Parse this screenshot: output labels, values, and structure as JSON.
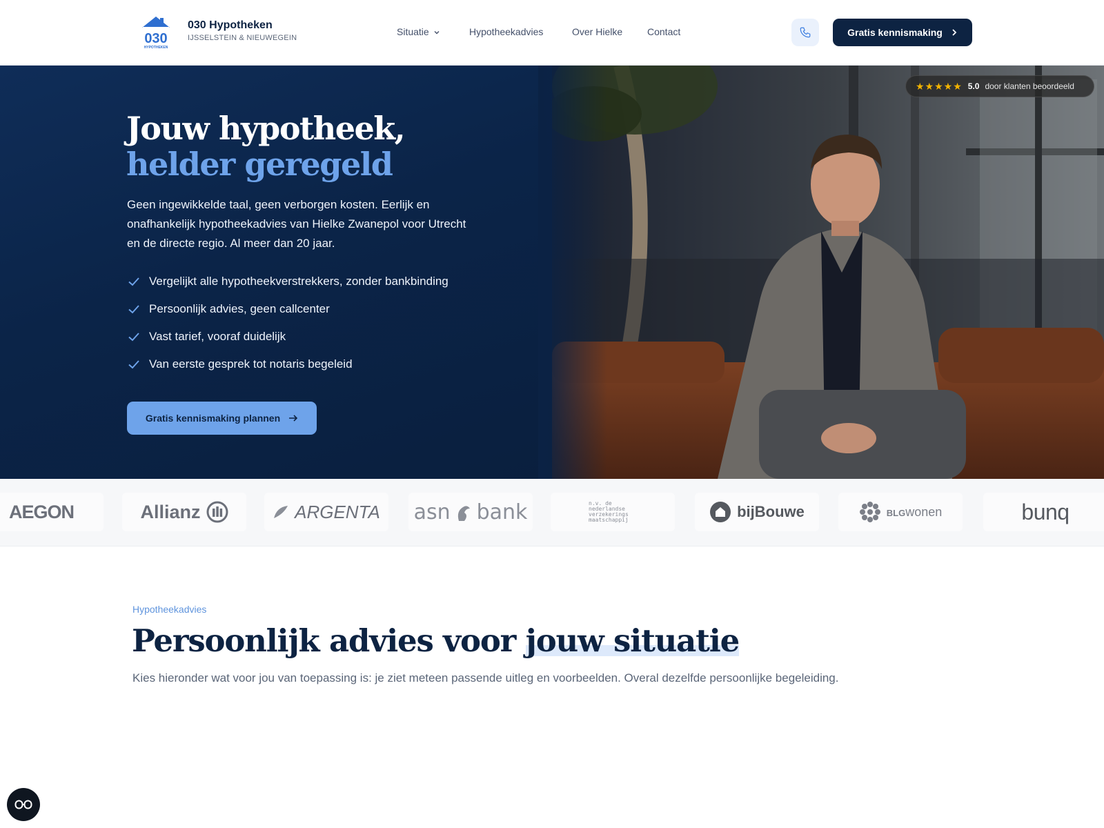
{
  "brand": {
    "logo_text": "030",
    "logo_sub": "HYPOTHEKEN",
    "name": "030 Hypotheken",
    "tagline": "IJSSELSTEIN & NIEUWEGEIN"
  },
  "nav": {
    "items": [
      {
        "label": "Situatie",
        "has_dropdown": true
      },
      {
        "label": "Hypotheekadvies"
      },
      {
        "label": "Over Hielke"
      },
      {
        "label": "Contact"
      }
    ],
    "phone_icon": "phone-icon",
    "cta_label": "Gratis kennismaking"
  },
  "hero": {
    "title_line1": "Jouw hypotheek,",
    "title_line2": "helder geregeld",
    "lead": "Geen ingewikkelde taal, geen verborgen kosten. Eerlijk en onafhankelijk hypotheekadvies van Hielke Zwanepol voor Utrecht en de directe regio. Al meer dan 20 jaar.",
    "checks": [
      "Vergelijkt alle hypotheekverstrekkers, zonder bankbinding",
      "Persoonlijk advies, geen callcenter",
      "Vast tarief, vooraf duidelijk",
      "Van eerste gesprek tot notaris begeleid"
    ],
    "cta_label": "Gratis kennismaking plannen",
    "rating": {
      "stars": "★★★★★",
      "score": "5.0",
      "text": "door klanten beoordeeld"
    }
  },
  "partners": [
    {
      "name": "AEGON"
    },
    {
      "name": "Allianz"
    },
    {
      "name": "ARGENTA"
    },
    {
      "name_a": "asn",
      "name_b": "bank"
    },
    {
      "name": "n.v. de nederlandse verzekerings maatschappij"
    },
    {
      "name": "bijBouwe"
    },
    {
      "name_a": "BLG",
      "name_b": "wonen"
    },
    {
      "name": "bunq"
    }
  ],
  "section": {
    "eyebrow": "Hypotheekadvies",
    "title_part1": "Persoonlijk advies voor ",
    "title_highlight": "jouw situatie",
    "lead": "Kies hieronder wat voor jou van toepassing is: je ziet meteen passende uitleg en voorbeelden. Overal dezelfde persoonlijke begeleiding."
  },
  "colors": {
    "navy": "#0d2342",
    "accent": "#6ea3ea",
    "star": "#f4b400"
  }
}
